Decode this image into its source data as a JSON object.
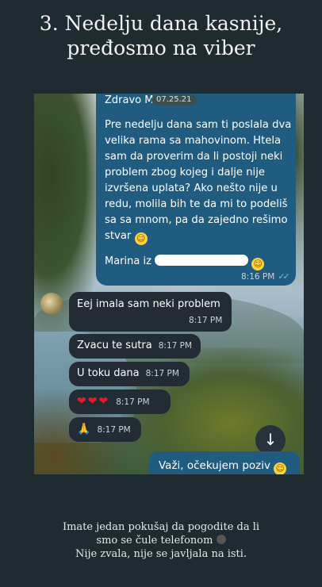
{
  "header": {
    "line1": "3. Nedelju dana kasnije,",
    "line2": "pređosmo na viber"
  },
  "chat": {
    "outgoing_long": {
      "greeting": "Zdravo Mi",
      "edited_stamp": "07.25.21",
      "body": "Pre nedelju dana sam ti poslala dva velika rama sa mahovinom. Htela sam da proverim da li postoji neki problem zbog kojeg i dalje nije izvršena uplata? Ako nešto nije u redu, molila bih te da mi to podeliš sa sa mnom, pa da zajedno rešimo stvar",
      "signature": "Marina iz",
      "time": "8:16 PM",
      "ticks": "✓✓"
    },
    "incoming": [
      {
        "text": "Eej imala sam neki problem",
        "time": "8:17 PM"
      },
      {
        "text": "Zvacu te sutra",
        "time": "8:17 PM"
      },
      {
        "text": "U toku dana",
        "time": "8:17 PM"
      },
      {
        "text": "❤❤❤",
        "time": "8:17 PM"
      },
      {
        "text": "🙏",
        "time": "8:17 PM"
      }
    ],
    "outgoing_last": {
      "text": "Važi, očekujem poziv"
    },
    "scroll_icon": "arrow-down-icon"
  },
  "caption": {
    "line1": "Imate jedan pokušaj da pogodite da li",
    "line2": "smo se čule telefonom",
    "line3": "Nije zvala, nije se javljala na isti."
  },
  "colors": {
    "page_bg": "#1e2b30",
    "outgoing_bubble": "#1f5c7f",
    "incoming_bubble": "#232c34"
  }
}
